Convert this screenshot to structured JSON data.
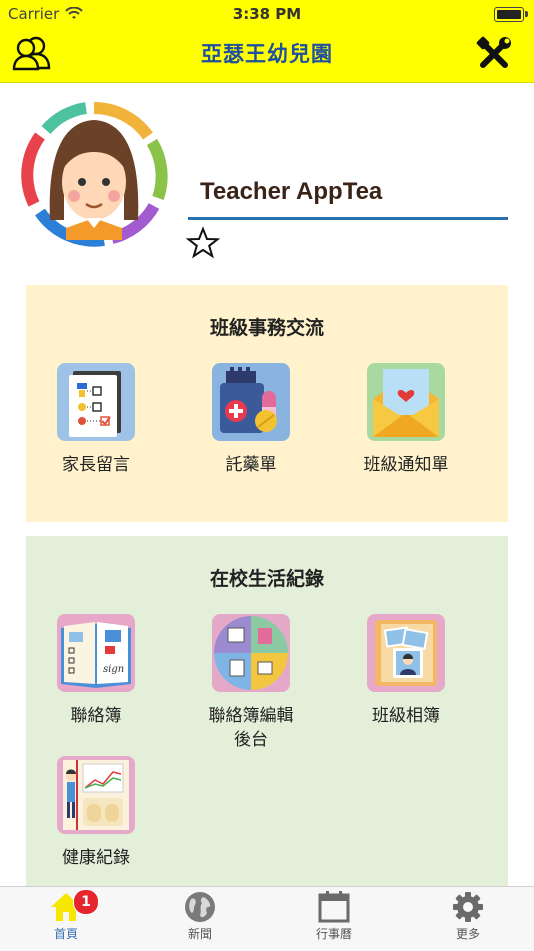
{
  "status_bar": {
    "carrier": "Carrier",
    "time": "3:38 PM"
  },
  "nav": {
    "title": "亞瑟王幼兒園",
    "left_icon": "users-icon",
    "right_icon": "tools-icon"
  },
  "profile": {
    "name": "Teacher AppTea",
    "favorite_icon": "star-outline-icon"
  },
  "section_class": {
    "title": "班級事務交流",
    "items": [
      {
        "label": "家長留言",
        "icon": "checklist-icon"
      },
      {
        "label": "託藥單",
        "icon": "medicine-icon"
      },
      {
        "label": "班級通知單",
        "icon": "envelope-icon"
      }
    ]
  },
  "section_school": {
    "title": "在校生活紀錄",
    "items": [
      {
        "label": "聯絡簿",
        "icon": "contact-book-icon"
      },
      {
        "label": "聯絡簿編輯\n後台",
        "icon": "editor-backend-icon"
      },
      {
        "label": "班級相簿",
        "icon": "photo-album-icon"
      },
      {
        "label": "健康紀錄",
        "icon": "health-record-icon"
      }
    ]
  },
  "tabbar": {
    "tabs": [
      {
        "label": "首頁",
        "icon": "home-icon",
        "badge": "1",
        "active": true
      },
      {
        "label": "新聞",
        "icon": "globe-icon"
      },
      {
        "label": "行事曆",
        "icon": "calendar-icon"
      },
      {
        "label": "更多",
        "icon": "gear-icon"
      }
    ]
  },
  "colors": {
    "nav_bg": "#ffff00",
    "title": "#1f4fa0",
    "panel_yellow": "#fff2cc",
    "panel_green": "#e4efda",
    "accent_line": "#2a6fb0",
    "badge": "#e5262c"
  }
}
